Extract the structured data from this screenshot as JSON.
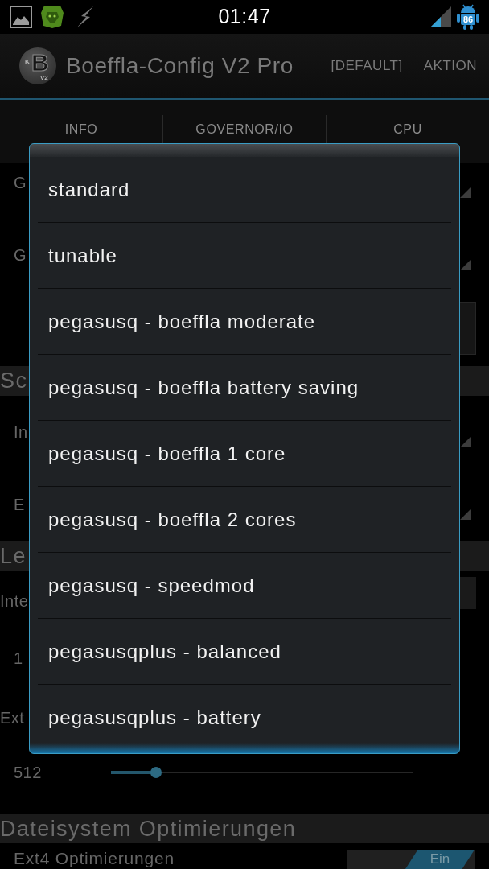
{
  "status_bar": {
    "time": "01:47",
    "battery": "86"
  },
  "action_bar": {
    "logo": {
      "letter": "B",
      "initial": "K",
      "version": "V2"
    },
    "title": "Boeffla-Config V2 Pro",
    "actions": [
      "[DEFAULT]",
      "AKTION"
    ]
  },
  "tabs": [
    {
      "label": "INFO"
    },
    {
      "label": "GOVERNOR/IO"
    },
    {
      "label": "CPU"
    }
  ],
  "governor": {
    "rows": [
      {
        "label": "G"
      },
      {
        "label": "G"
      }
    ]
  },
  "scheduler": {
    "title": "Sc",
    "rows": [
      {
        "label": "In"
      },
      {
        "label": "E"
      }
    ]
  },
  "read_buffer": {
    "title": "Le",
    "rows": [
      {
        "label": "Inte",
        "reading": "1"
      },
      {
        "label": "Ext",
        "reading": "512",
        "level": 0.15
      }
    ]
  },
  "filesystem": {
    "title": "Dateisystem Optimierungen",
    "rows": [
      {
        "label": "Ext4 Optimierungen",
        "toggle": "Ein",
        "on": true
      }
    ]
  },
  "dialog": {
    "options": [
      "standard",
      "tunable",
      "pegasusq - boeffla moderate",
      "pegasusq - boeffla battery saving",
      "pegasusq - boeffla 1 core",
      "pegasusq - boeffla 2 cores",
      "pegasusq - speedmod",
      "pegasusqplus - balanced",
      "pegasusqplus - battery"
    ]
  }
}
